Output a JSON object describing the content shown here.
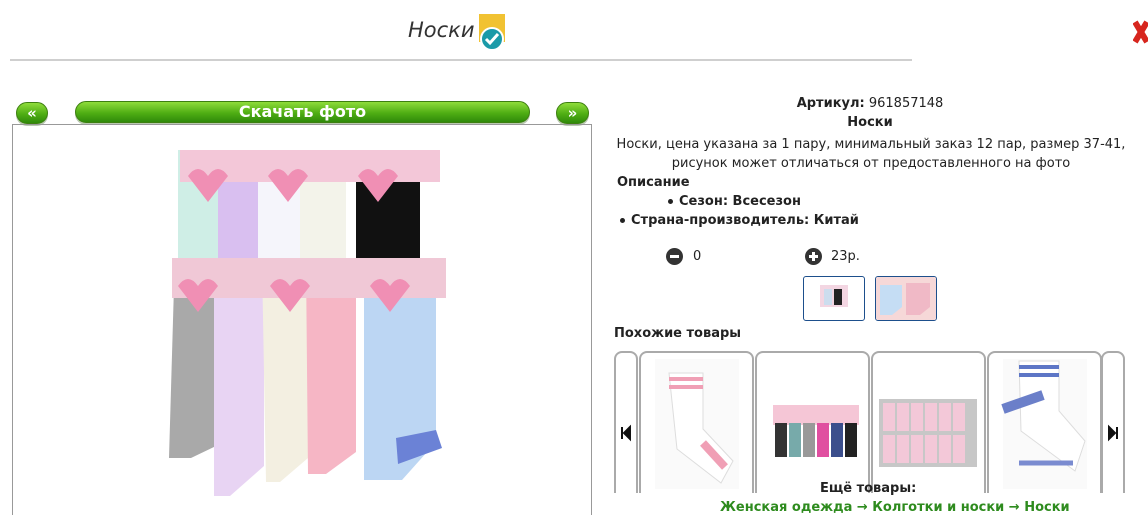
{
  "header": {
    "title": "Носки"
  },
  "nav": {
    "prev_label": "«",
    "download_label": "Скачать фото",
    "next_label": "»"
  },
  "product": {
    "sku_label": "Артикул:",
    "sku_value": "961857148",
    "name": "Носки",
    "description": "Носки, цена указана за 1 пару, минимальный заказ 12 пар, размер 37-41, рисунок может отличаться от предоставленного на фото",
    "description_heading": "Описание",
    "properties": [
      {
        "text": "Сезон: Всесезон"
      },
      {
        "text": "Страна-производитель: Китай"
      }
    ],
    "quantity": "0",
    "price": "23р."
  },
  "similar": {
    "heading": "Похожие товары"
  },
  "more": {
    "heading": "Ещё товары:",
    "breadcrumbs": "Женская одежда → Колготки и носки → Носки"
  },
  "colors": {
    "accent_green": "#4fae14",
    "thumb_border": "#1d4f8c"
  },
  "icons": [
    "check-badge-icon",
    "close-icon",
    "minus-circle-icon",
    "plus-circle-icon",
    "prev-arrow-icon",
    "next-arrow-icon"
  ]
}
